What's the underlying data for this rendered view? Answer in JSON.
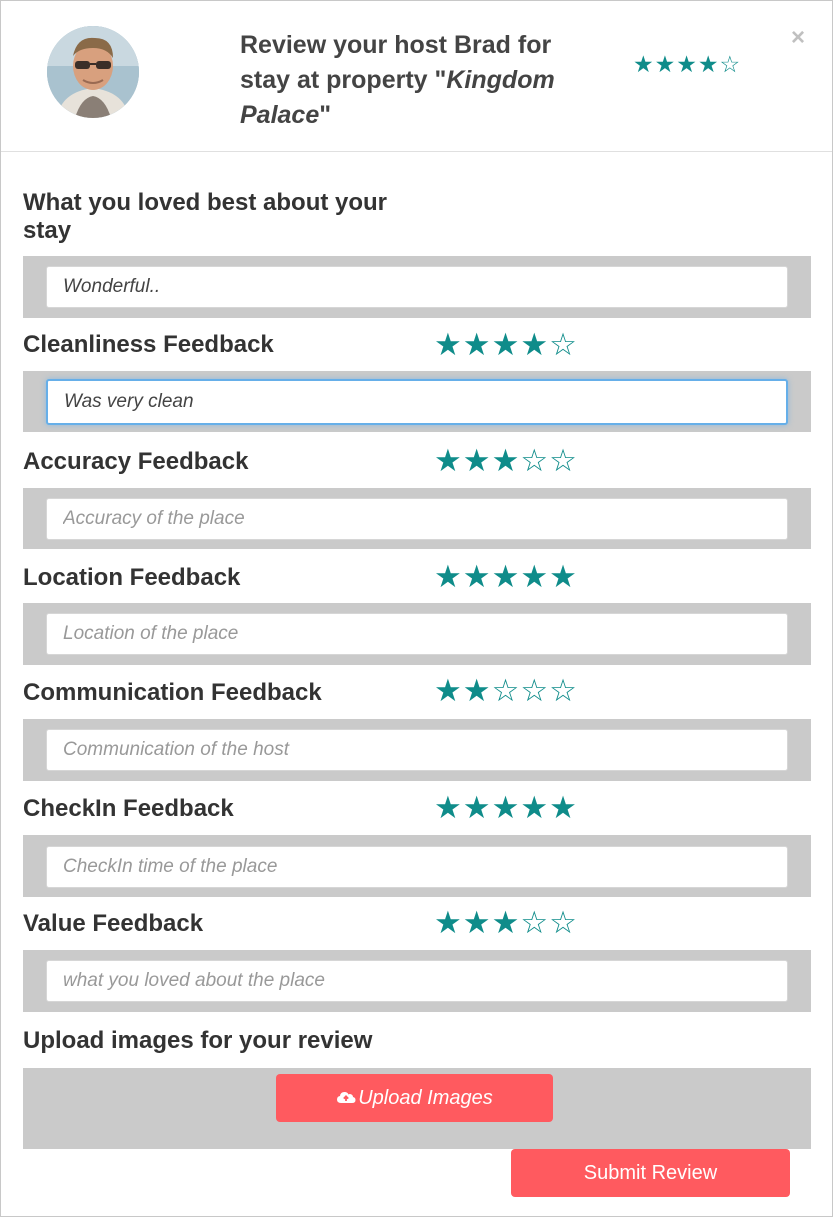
{
  "header": {
    "title_prefix": "Review your host ",
    "host_name": "Brad",
    "title_middle": " for stay at property \"",
    "property_name": "Kingdom Palace",
    "title_suffix": "\"",
    "stars": "★★★★☆",
    "close_symbol": "×",
    "rating": 4
  },
  "sections": [
    {
      "label": "What you loved best about your stay",
      "value": "Wonderful..",
      "placeholder": ""
    },
    {
      "label": "Cleanliness Feedback",
      "stars": "★★★★☆",
      "rating": 4,
      "value": "Was very clean",
      "placeholder": ""
    },
    {
      "label": "Accuracy Feedback",
      "stars": "★★★☆☆",
      "rating": 3,
      "value": "",
      "placeholder": "Accuracy of the place"
    },
    {
      "label": "Location Feedback",
      "stars": "★★★★★",
      "rating": 5,
      "value": "",
      "placeholder": "Location of the place"
    },
    {
      "label": "Communication Feedback",
      "stars": "★★☆☆☆",
      "rating": 2,
      "value": "",
      "placeholder": "Communication of the host"
    },
    {
      "label": "CheckIn Feedback",
      "stars": "★★★★★",
      "rating": 5,
      "value": "",
      "placeholder": "CheckIn time of the place"
    },
    {
      "label": "Value Feedback",
      "stars": "★★★☆☆",
      "rating": 3,
      "value": "",
      "placeholder": "what you loved about the place"
    }
  ],
  "upload": {
    "label": "Upload images for your review",
    "button_label": "Upload Images",
    "icon": "cloud-upload-icon"
  },
  "submit_label": "Submit Review",
  "colors": {
    "star": "#0f8c8a",
    "button": "#ff5a5f",
    "band": "#cacaca",
    "focus_border": "#66afe9"
  }
}
